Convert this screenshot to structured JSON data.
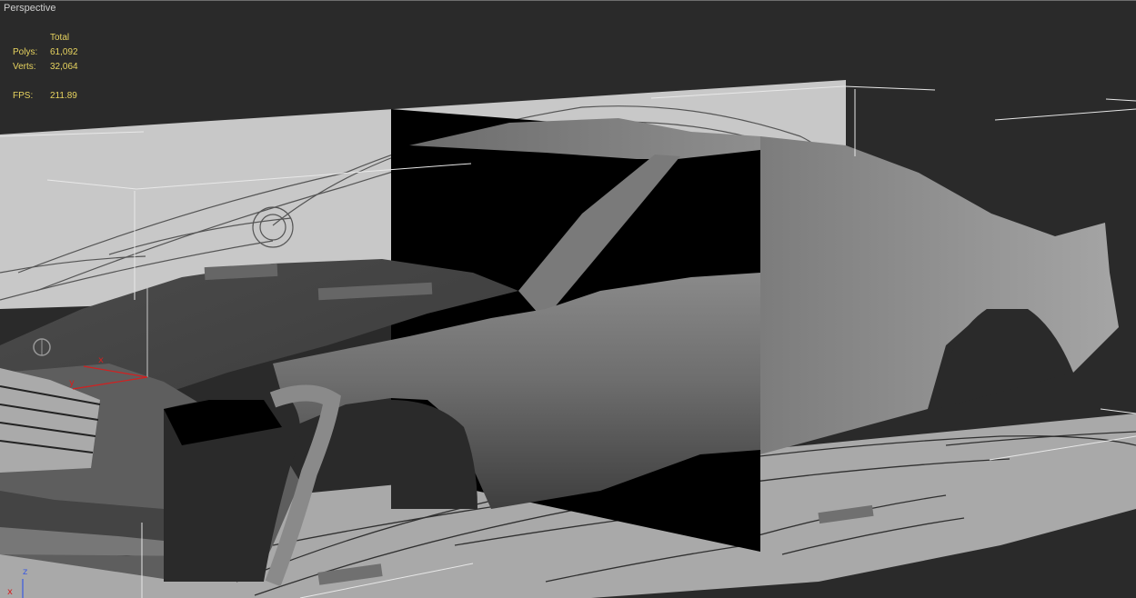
{
  "viewport": {
    "label": "Perspective",
    "stats": {
      "header": "Total",
      "polys_label": "Polys:",
      "polys_value": "61,092",
      "verts_label": "Verts:",
      "verts_value": "32,064",
      "fps_label": "FPS:",
      "fps_value": "211.89"
    },
    "axis": {
      "x": "x",
      "y": "y",
      "z": "z"
    }
  },
  "colors": {
    "viewport_bg": "#2a2a2a",
    "stats_text": "#e7d35f",
    "axis_red": "#d32020",
    "axis_blue": "#3a59e0",
    "grid_line": "#e8e8e8"
  }
}
